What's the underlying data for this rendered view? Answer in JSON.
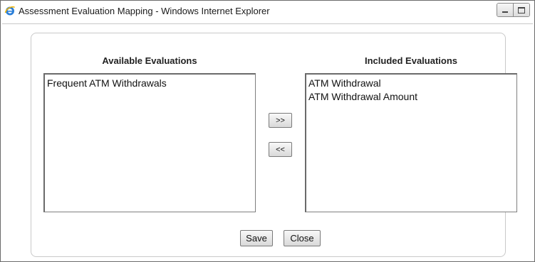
{
  "window": {
    "title": "Assessment Evaluation Mapping - Windows Internet Explorer"
  },
  "available": {
    "heading": "Available Evaluations",
    "items": [
      "Frequent ATM Withdrawals"
    ]
  },
  "included": {
    "heading": "Included Evaluations",
    "items": [
      "ATM Withdrawal",
      "ATM Withdrawal Amount"
    ]
  },
  "transfer": {
    "add_label": ">>",
    "remove_label": "<<"
  },
  "actions": {
    "save_label": "Save",
    "close_label": "Close"
  },
  "icons": {
    "app": "ie-icon",
    "minimize": "minimize-icon",
    "maximize": "maximize-icon"
  }
}
